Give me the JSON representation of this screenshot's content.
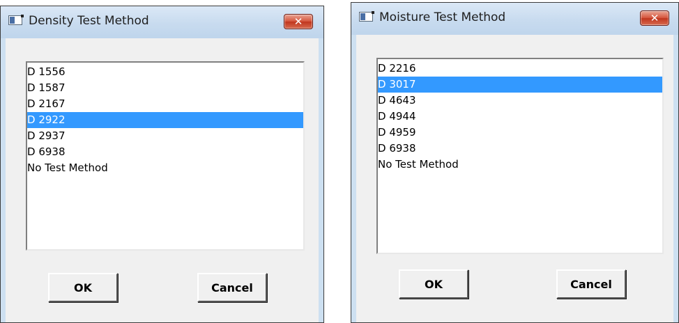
{
  "dialogs": [
    {
      "title": "Density Test Method",
      "items": [
        "D 1556",
        "D 1587",
        "D 2167",
        "D 2922",
        "D 2937",
        "D 6938",
        "No Test Method"
      ],
      "selected_item": "D 2922",
      "ok_label": "OK",
      "cancel_label": "Cancel",
      "close_glyph": "✕"
    },
    {
      "title": "Moisture Test Method",
      "items": [
        "D 2216",
        "D 3017",
        "D 4643",
        "D 4944",
        "D 4959",
        "D 6938",
        "No Test Method"
      ],
      "selected_item": "D 3017",
      "ok_label": "OK",
      "cancel_label": "Cancel",
      "close_glyph": "✕"
    }
  ],
  "colors": {
    "selection": "#3399ff",
    "frame": "#cde0f1",
    "close_button": "#c7462c"
  },
  "icons": [
    "app-window-icon",
    "close-icon"
  ]
}
